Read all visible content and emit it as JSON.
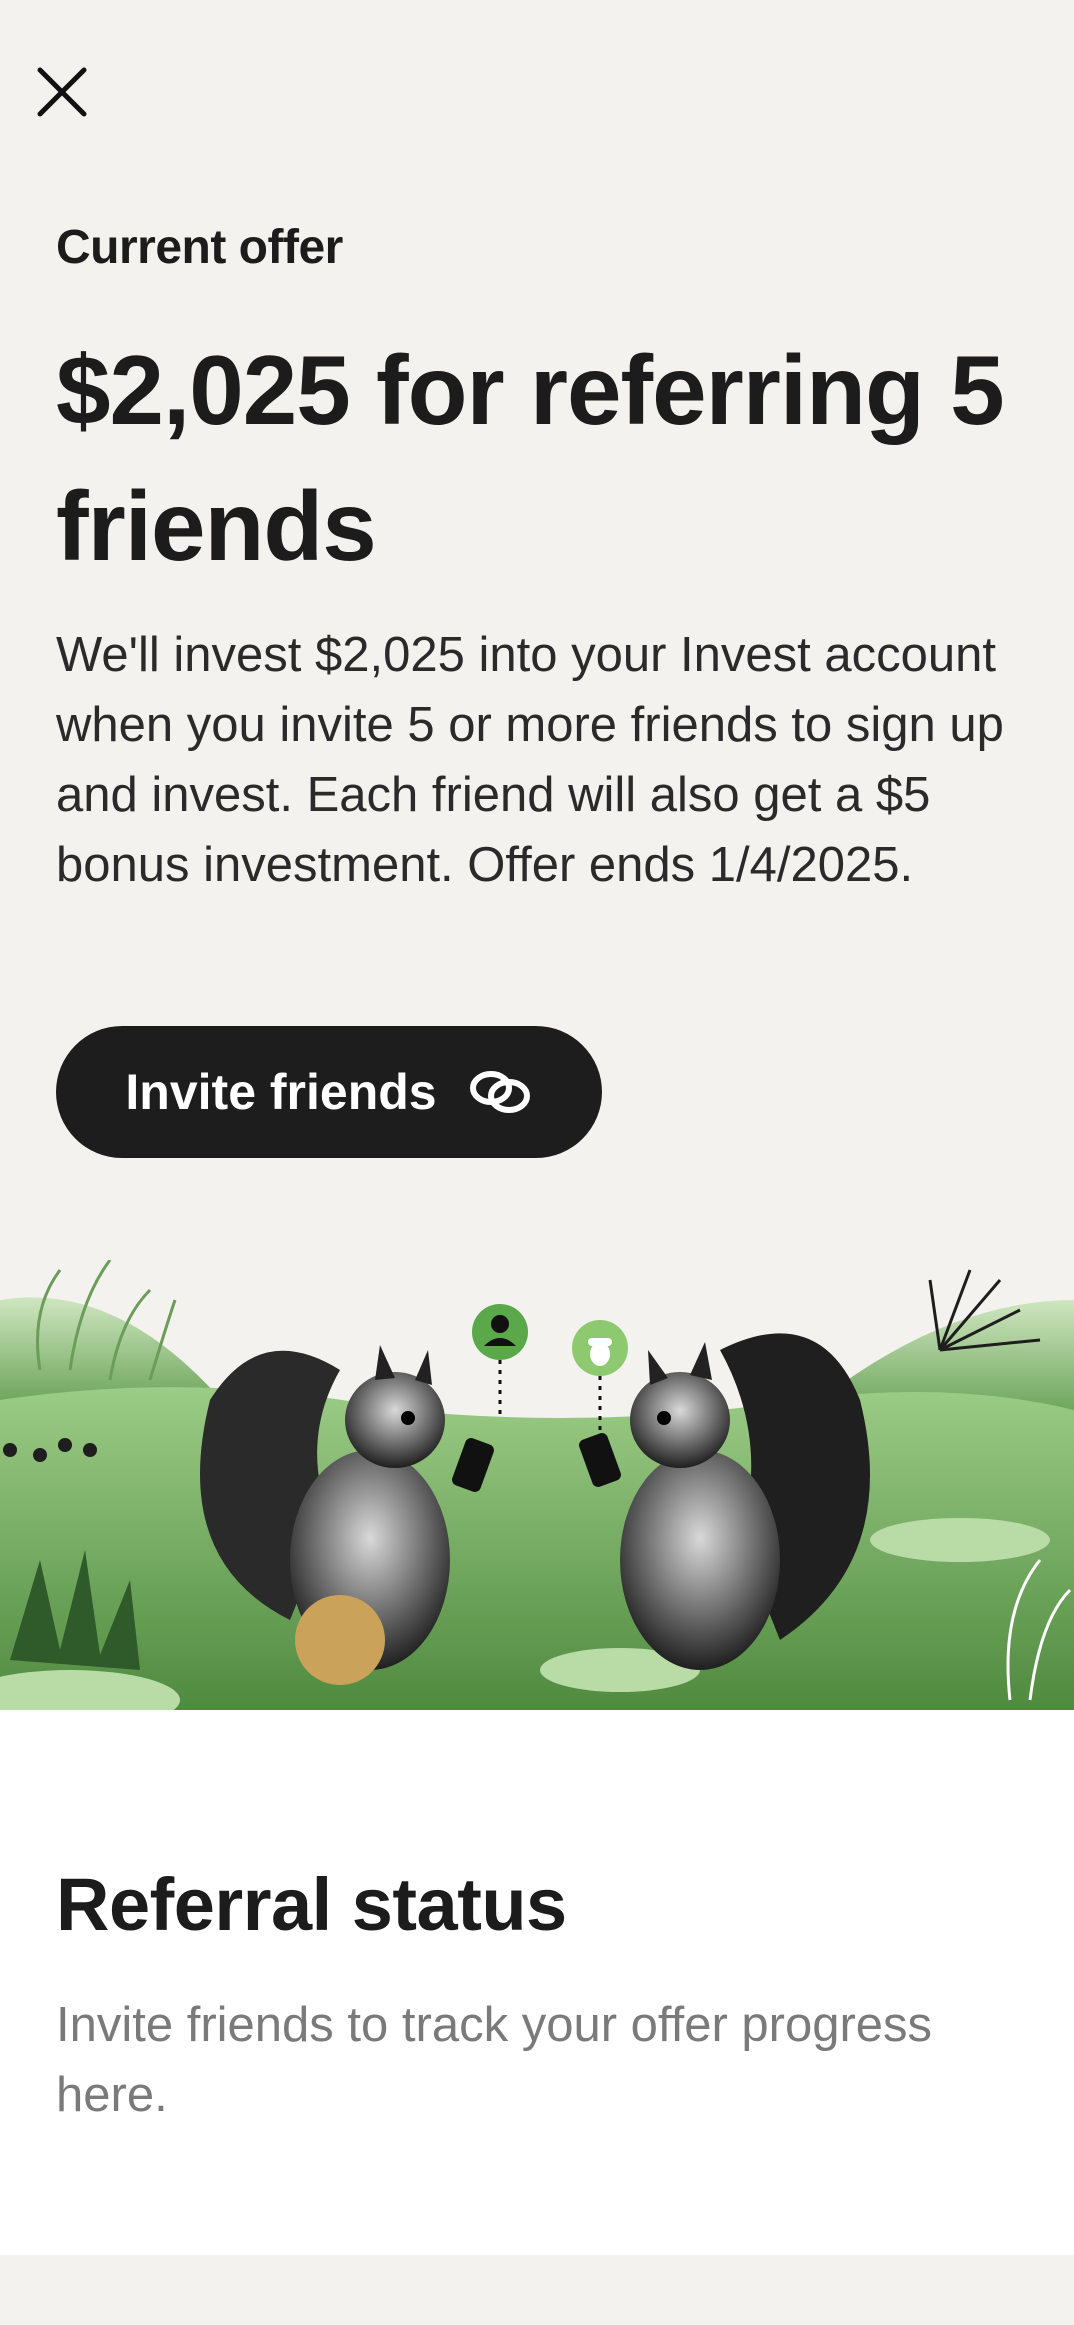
{
  "offer": {
    "eyebrow": "Current offer",
    "headline": "$2,025 for referring 5 friends",
    "description": "We'll invest $2,025 into your Invest account when you invite 5 or more friends to sign up and invest. Each friend will also get a $5 bonus investment. Offer ends 1/4/2025.",
    "invite_button_label": "Invite friends"
  },
  "referral_status": {
    "title": "Referral status",
    "description": "Invite friends to track your offer progress here."
  },
  "icons": {
    "close": "close-icon",
    "invite": "link-icon"
  },
  "colors": {
    "background": "#f3f2ef",
    "button": "#1d1d1d",
    "button_text": "#ffffff",
    "accent_green": "#6fae5b",
    "muted_text": "#7a7a7a"
  }
}
